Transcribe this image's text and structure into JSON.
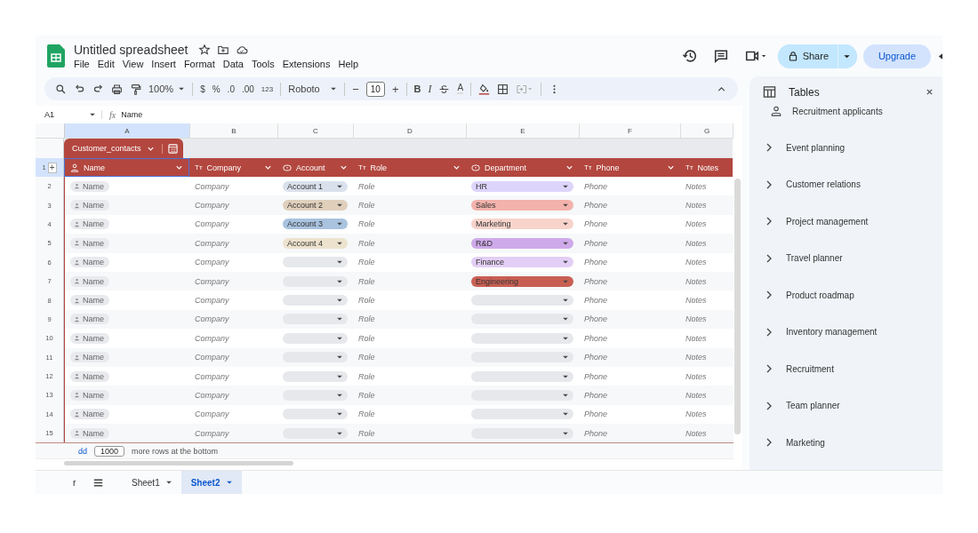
{
  "app": {
    "title": "Untitled spreadsheet",
    "menu": [
      "File",
      "Edit",
      "View",
      "Insert",
      "Format",
      "Data",
      "Tools",
      "Extensions",
      "Help"
    ],
    "share": "Share",
    "upgrade": "Upgrade"
  },
  "toolbar": {
    "zoom": "100%",
    "currency": "$",
    "percent": "%",
    "dec_decrease": ".0",
    "dec_increase": ".00",
    "number_format": "123",
    "font": "Roboto",
    "minus": "−",
    "font_size": "10",
    "plus": "+",
    "bold": "B",
    "italic": "I",
    "text_color": "A"
  },
  "formula_bar": {
    "cell": "A1",
    "fx": "fx",
    "value": "Name"
  },
  "column_letters": [
    {
      "label": "A",
      "selected": true
    },
    {
      "label": "B",
      "selected": false
    },
    {
      "label": "C",
      "selected": false
    },
    {
      "label": "D",
      "selected": false
    },
    {
      "label": "E",
      "selected": false
    },
    {
      "label": "F",
      "selected": false
    },
    {
      "label": "G",
      "selected": false
    }
  ],
  "table": {
    "name": "Customer_contacts",
    "header_row": "1",
    "add": "+",
    "columns": [
      {
        "label": "Name",
        "kind": "person"
      },
      {
        "label": "Company",
        "kind": "text",
        "glyph": "Tт"
      },
      {
        "label": "Account",
        "kind": "dropdown"
      },
      {
        "label": "Role",
        "kind": "text",
        "glyph": "Tт"
      },
      {
        "label": "Department",
        "kind": "dropdown"
      },
      {
        "label": "Phone",
        "kind": "text",
        "glyph": "Tт"
      },
      {
        "label": "Notes",
        "kind": "text",
        "glyph": "Tт"
      }
    ],
    "rows": [
      {
        "number": "2",
        "name": "Name",
        "company": "Company",
        "account": {
          "label": "Account 1",
          "color": "#d9e1ec"
        },
        "role": "Role",
        "department": {
          "label": "HR",
          "color": "#ddd5fb"
        },
        "phone": "Phone",
        "notes": "Notes"
      },
      {
        "number": "3",
        "name": "Name",
        "company": "Company",
        "account": {
          "label": "Account 2",
          "color": "#dfcfbb"
        },
        "role": "Role",
        "department": {
          "label": "Sales",
          "color": "#f3b2ab"
        },
        "phone": "Phone",
        "notes": "Notes"
      },
      {
        "number": "4",
        "name": "Name",
        "company": "Company",
        "account": {
          "label": "Account 3",
          "color": "#a9c3df"
        },
        "role": "Role",
        "department": {
          "label": "Marketing",
          "color": "#f7d3cb"
        },
        "phone": "Phone",
        "notes": "Notes"
      },
      {
        "number": "5",
        "name": "Name",
        "company": "Company",
        "account": {
          "label": "Account 4",
          "color": "#ede2cd"
        },
        "role": "Role",
        "department": {
          "label": "R&D",
          "color": "#cfaaea"
        },
        "phone": "Phone",
        "notes": "Notes"
      },
      {
        "number": "6",
        "name": "Name",
        "company": "Company",
        "role": "Role",
        "department": {
          "label": "Finance",
          "color": "#e3cff5"
        },
        "phone": "Phone",
        "notes": "Notes"
      },
      {
        "number": "7",
        "name": "Name",
        "company": "Company",
        "role": "Role",
        "department": {
          "label": "Engineering",
          "color": "#c95f54"
        },
        "phone": "Phone",
        "notes": "Notes"
      },
      {
        "number": "8",
        "name": "Name",
        "company": "Company",
        "role": "Role",
        "phone": "Phone",
        "notes": "Notes"
      },
      {
        "number": "9",
        "name": "Name",
        "company": "Company",
        "role": "Role",
        "phone": "Phone",
        "notes": "Notes"
      },
      {
        "number": "10",
        "name": "Name",
        "company": "Company",
        "role": "Role",
        "phone": "Phone",
        "notes": "Notes"
      },
      {
        "number": "11",
        "name": "Name",
        "company": "Company",
        "role": "Role",
        "phone": "Phone",
        "notes": "Notes"
      },
      {
        "number": "12",
        "name": "Name",
        "company": "Company",
        "role": "Role",
        "phone": "Phone",
        "notes": "Notes"
      },
      {
        "number": "13",
        "name": "Name",
        "company": "Company",
        "role": "Role",
        "phone": "Phone",
        "notes": "Notes"
      },
      {
        "number": "14",
        "name": "Name",
        "company": "Company",
        "role": "Role",
        "phone": "Phone",
        "notes": "Notes"
      },
      {
        "number": "15",
        "name": "Name",
        "company": "Company",
        "role": "Role",
        "phone": "Phone",
        "notes": "Notes"
      }
    ]
  },
  "footer": {
    "add_link": "dd",
    "count": "1000",
    "text": "more rows at the bottom"
  },
  "sheet_bar": {
    "partial": "r",
    "sheets": [
      {
        "label": "Sheet1",
        "selected": false
      },
      {
        "label": "Sheet2",
        "selected": true
      }
    ]
  },
  "panel": {
    "title": "Tables",
    "featured": "Recruitment applicants",
    "categories": [
      "Event planning",
      "Customer relations",
      "Project management",
      "Travel planner",
      "Product roadmap",
      "Inventory management",
      "Recruitment",
      "Team planner",
      "Marketing"
    ]
  }
}
